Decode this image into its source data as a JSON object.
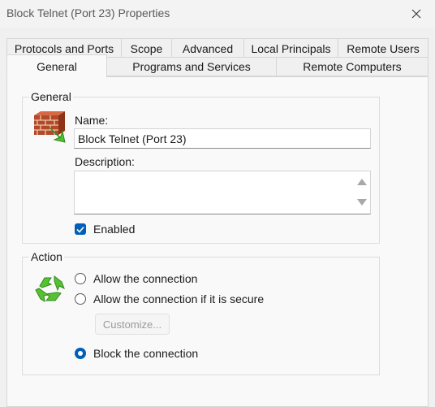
{
  "window": {
    "title": "Block Telnet (Port 23) Properties"
  },
  "tabs": {
    "row1": [
      {
        "label": "Protocols and Ports"
      },
      {
        "label": "Scope"
      },
      {
        "label": "Advanced"
      },
      {
        "label": "Local Principals"
      },
      {
        "label": "Remote Users"
      }
    ],
    "row2": [
      {
        "label": "General",
        "active": true
      },
      {
        "label": "Programs and Services"
      },
      {
        "label": "Remote Computers"
      }
    ]
  },
  "general_group": {
    "legend": "General",
    "icon": "firewall-rule-icon",
    "name_label": "Name:",
    "name_value": "Block Telnet (Port 23)",
    "description_label": "Description:",
    "description_value": "",
    "enabled_label": "Enabled",
    "enabled_checked": true
  },
  "action_group": {
    "legend": "Action",
    "icon": "recycle-arrows-icon",
    "options": [
      {
        "label": "Allow the connection",
        "checked": false
      },
      {
        "label": "Allow the connection if it is secure",
        "checked": false
      },
      {
        "label": "Block the connection",
        "checked": true
      }
    ],
    "customize_label": "Customize..."
  },
  "colors": {
    "accent": "#005fb8",
    "icon_green": "#4caf2a"
  }
}
